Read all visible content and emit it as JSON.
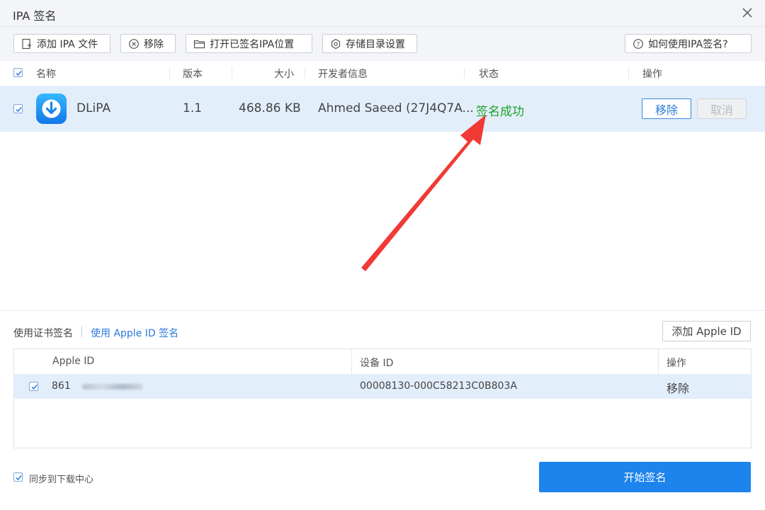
{
  "window": {
    "title": "IPA 签名"
  },
  "toolbar": {
    "add_ipa": "添加 IPA 文件",
    "remove": "移除",
    "open_signed": "打开已签名IPA位置",
    "storage_settings": "存储目录设置",
    "help": "如何使用IPA签名?"
  },
  "ipa_list": {
    "columns": {
      "name": "名称",
      "version": "版本",
      "size": "大小",
      "developer": "开发者信息",
      "status": "状态",
      "action": "操作"
    },
    "rows": [
      {
        "name": "DLiPA",
        "version": "1.1",
        "size": "468.86 KB",
        "developer": "Ahmed Saeed (27J4Q7A...",
        "status": "签名成功",
        "remove": "移除",
        "cancel": "取消"
      }
    ]
  },
  "sign_mode": {
    "cert": "使用证书签名",
    "apple_id": "使用 Apple ID 签名",
    "add_apple_id": "添加 Apple ID"
  },
  "apple_table": {
    "columns": {
      "apple_id": "Apple ID",
      "device_id": "设备 ID",
      "action": "操作"
    },
    "rows": [
      {
        "apple_id": "861",
        "device_id": "00008130-000C58213C0B803A",
        "action": "移除"
      }
    ]
  },
  "footer": {
    "sync": "同步到下载中心",
    "start": "开始签名"
  },
  "colors": {
    "accent": "#1d83ed",
    "success": "#1aa32a",
    "row_selected": "#e3eefb"
  }
}
